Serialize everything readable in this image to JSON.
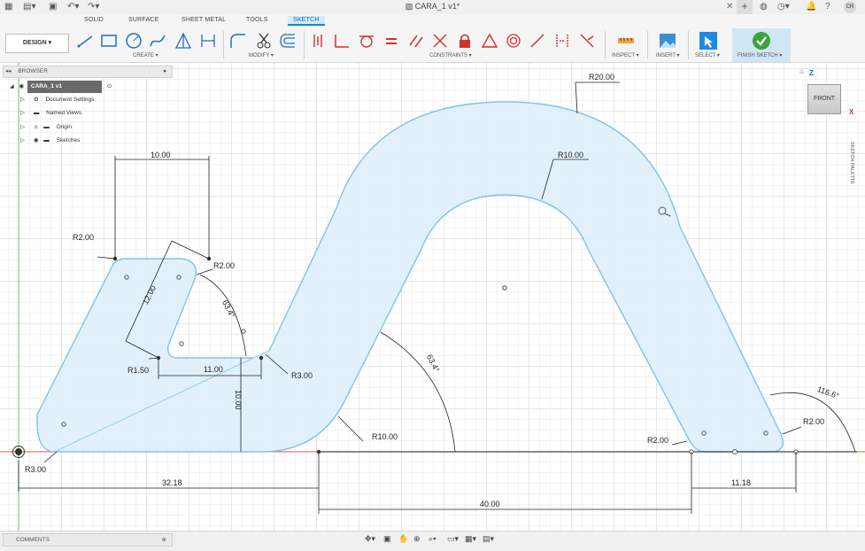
{
  "window": {
    "doc_title": "CARA_1 v1*",
    "user_initials": "CR"
  },
  "ribbon": {
    "tabs": [
      "SOLID",
      "SURFACE",
      "SHEET METAL",
      "TOOLS",
      "SKETCH"
    ],
    "active_tab": "SKETCH",
    "design_button": "DESIGN ▾",
    "groups": [
      "CREATE ▾",
      "MODIFY ▾",
      "CONSTRAINTS ▾",
      "INSPECT ▾",
      "INSERT ▾",
      "SELECT ▾",
      "FINISH SKETCH ▾"
    ]
  },
  "browser": {
    "title": "BROWSER",
    "root": "CARA_1 v1",
    "items": [
      "Document Settings",
      "Named Views",
      "Origin",
      "Sketches"
    ]
  },
  "comments": {
    "title": "COMMENTS"
  },
  "viewcube": {
    "face": "FRONT",
    "axis_z": "Z",
    "axis_x": "X"
  },
  "side_palette": {
    "label": "SKETCH PALETTE"
  },
  "dimensions": {
    "top_width": "10.00",
    "slant_length": "12.00",
    "r_top_left": "R2.00",
    "r_top_right": "R2.00",
    "angle_small": "63.4°",
    "r_inner_bottom": "R1.50",
    "inner_width": "11.00",
    "r_fillet": "R3.00",
    "height": "10.00",
    "r_outer_arch": "R20.00",
    "r_inner_arch": "R10.00",
    "angle_large": "63.4°",
    "r_bottom_arc": "R10.00",
    "r_origin": "R3.00",
    "r_right_bottom_left": "R2.00",
    "r_right_bottom_right": "R2.00",
    "angle_right": "116.6°",
    "dist_origin": "32.18",
    "dist_center": "40.00",
    "dist_right": "11.18"
  }
}
